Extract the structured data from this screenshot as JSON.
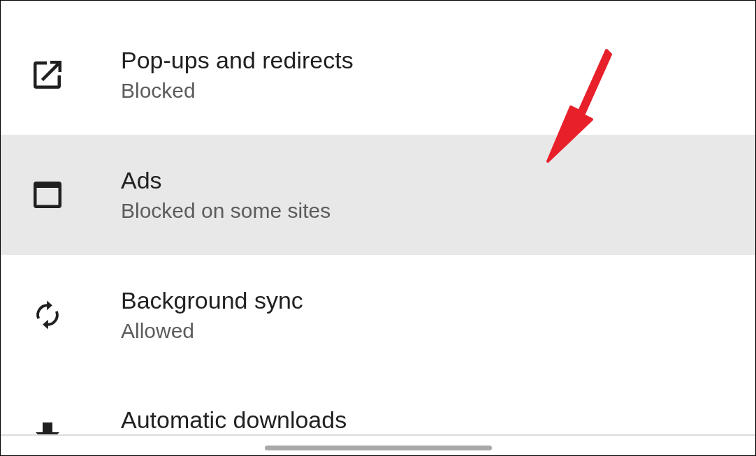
{
  "settings": [
    {
      "kind": "popup",
      "title": "Pop-ups and redirects",
      "subtitle": "Blocked",
      "selected": false
    },
    {
      "kind": "window",
      "title": "Ads",
      "subtitle": "Blocked on some sites",
      "selected": true
    },
    {
      "kind": "sync",
      "title": "Background sync",
      "subtitle": "Allowed",
      "selected": false
    },
    {
      "kind": "download",
      "title": "Automatic downloads",
      "selected": false
    }
  ]
}
